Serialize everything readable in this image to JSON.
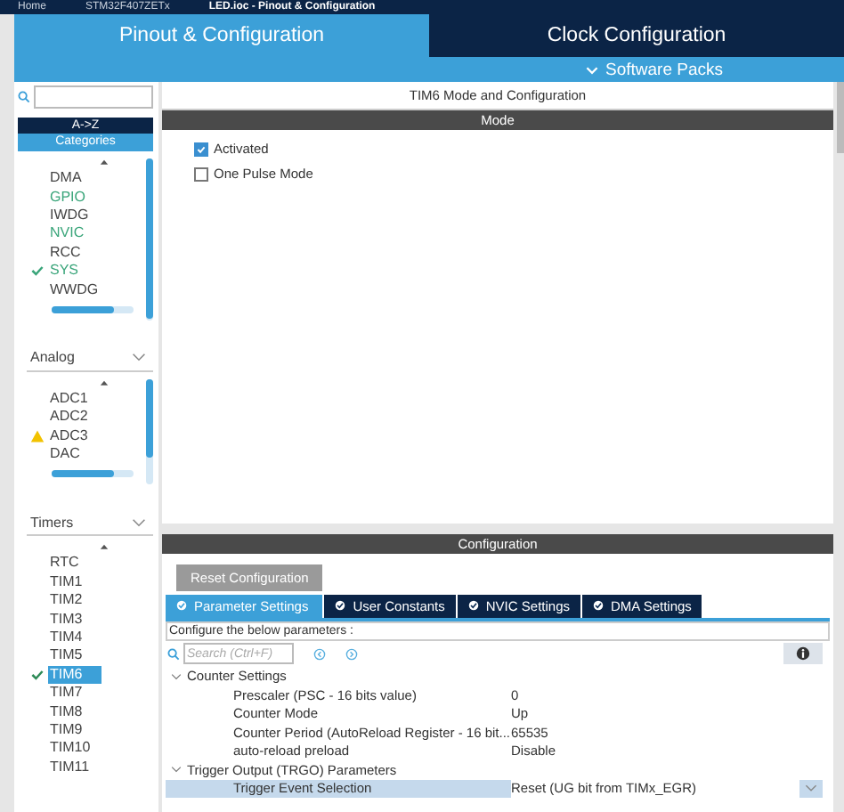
{
  "breadcrumb": [
    "Home",
    "STM32F407ZETx",
    "LED.ioc - Pinout & Configuration"
  ],
  "tabs": [
    {
      "label": "Pinout & Configuration",
      "selected": true
    },
    {
      "label": "Clock Configuration",
      "selected": false
    }
  ],
  "software_packs": {
    "label": "Software Packs"
  },
  "sidebar": {
    "sort_buttons": [
      {
        "label": "A->Z",
        "selected": false
      },
      {
        "label": "Categories",
        "selected": true
      }
    ],
    "groups": [
      {
        "items": [
          {
            "label": "DMA",
            "active": false,
            "configured": false,
            "warning": false,
            "selected": false
          },
          {
            "label": "GPIO",
            "active": true,
            "configured": false,
            "warning": false,
            "selected": false
          },
          {
            "label": "IWDG",
            "active": false,
            "configured": false,
            "warning": false,
            "selected": false
          },
          {
            "label": "NVIC",
            "active": true,
            "configured": false,
            "warning": false,
            "selected": false
          },
          {
            "label": "RCC",
            "active": false,
            "configured": false,
            "warning": false,
            "selected": false
          },
          {
            "label": "SYS",
            "active": true,
            "configured": true,
            "warning": false,
            "selected": false
          },
          {
            "label": "WWDG",
            "active": false,
            "configured": false,
            "warning": false,
            "selected": false
          }
        ]
      },
      {
        "label": "Analog",
        "expanded": true,
        "items": [
          {
            "label": "ADC1",
            "active": false,
            "configured": false,
            "warning": false,
            "selected": false
          },
          {
            "label": "ADC2",
            "active": false,
            "configured": false,
            "warning": false,
            "selected": false
          },
          {
            "label": "ADC3",
            "active": false,
            "configured": false,
            "warning": true,
            "selected": false
          },
          {
            "label": "DAC",
            "active": false,
            "configured": false,
            "warning": false,
            "selected": false
          }
        ]
      },
      {
        "label": "Timers",
        "expanded": true,
        "items": [
          {
            "label": "RTC",
            "active": false,
            "configured": false,
            "warning": false,
            "selected": false
          },
          {
            "label": "TIM1",
            "active": false,
            "configured": false,
            "warning": false,
            "selected": false
          },
          {
            "label": "TIM2",
            "active": false,
            "configured": false,
            "warning": false,
            "selected": false
          },
          {
            "label": "TIM3",
            "active": false,
            "configured": false,
            "warning": false,
            "selected": false
          },
          {
            "label": "TIM4",
            "active": false,
            "configured": false,
            "warning": false,
            "selected": false
          },
          {
            "label": "TIM5",
            "active": false,
            "configured": false,
            "warning": false,
            "selected": false
          },
          {
            "label": "TIM6",
            "active": true,
            "configured": true,
            "warning": false,
            "selected": true
          },
          {
            "label": "TIM7",
            "active": false,
            "configured": false,
            "warning": false,
            "selected": false
          },
          {
            "label": "TIM8",
            "active": false,
            "configured": false,
            "warning": false,
            "selected": false
          },
          {
            "label": "TIM9",
            "active": false,
            "configured": false,
            "warning": false,
            "selected": false
          },
          {
            "label": "TIM10",
            "active": false,
            "configured": false,
            "warning": false,
            "selected": false
          },
          {
            "label": "TIM11",
            "active": false,
            "configured": false,
            "warning": false,
            "selected": false
          }
        ]
      }
    ]
  },
  "panel_title": "TIM6 Mode and Configuration",
  "mode": {
    "header": "Mode",
    "options": [
      {
        "label": "Activated",
        "checked": true
      },
      {
        "label": "One Pulse Mode",
        "checked": false
      }
    ]
  },
  "configuration": {
    "header": "Configuration",
    "reset_button": "Reset Configuration",
    "tabs": [
      {
        "label": "Parameter Settings",
        "selected": true
      },
      {
        "label": "User Constants",
        "selected": false
      },
      {
        "label": "NVIC Settings",
        "selected": false
      },
      {
        "label": "DMA Settings",
        "selected": false
      }
    ],
    "hint": "Configure the below parameters :",
    "search": {
      "placeholder": "Search (Ctrl+F)"
    },
    "parameters": [
      {
        "label": "Counter Settings",
        "expanded": true,
        "children": [
          {
            "name": "Prescaler (PSC - 16 bits value)",
            "value": "0",
            "selected": false
          },
          {
            "name": "Counter Mode",
            "value": "Up",
            "selected": false
          },
          {
            "name": "Counter Period (AutoReload Register - 16 bit...",
            "value": "65535",
            "selected": false
          },
          {
            "name": "auto-reload preload",
            "value": "Disable",
            "selected": false
          }
        ]
      },
      {
        "label": "Trigger Output (TRGO) Parameters",
        "expanded": true,
        "children": [
          {
            "name": "Trigger Event Selection",
            "value": "Reset (UG bit from TIMx_EGR)",
            "selected": true
          }
        ]
      }
    ]
  }
}
